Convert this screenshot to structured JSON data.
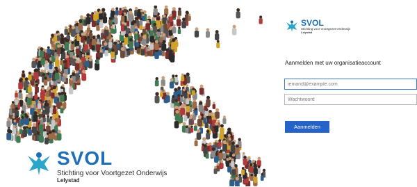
{
  "colors": {
    "brand_blue": "#1f6fb8",
    "button_blue": "#2563c9",
    "logo_teal": "#2ba6c9"
  },
  "hero": {
    "brand": "SVOL",
    "subtitle": "Stichting voor Voortgezet Onderwijs",
    "city": "Lelystad",
    "image": "crowd-forming-curve"
  },
  "login": {
    "logo_brand": "SVOL",
    "logo_subtitle": "Stichting voor Voortgezet Onderwijs",
    "logo_city": "Lelystad",
    "heading": "Aanmelden met uw organisatieaccount",
    "email_placeholder": "iemand@example.com",
    "password_placeholder": "Wachtwoord",
    "submit_label": "Aanmelden"
  }
}
